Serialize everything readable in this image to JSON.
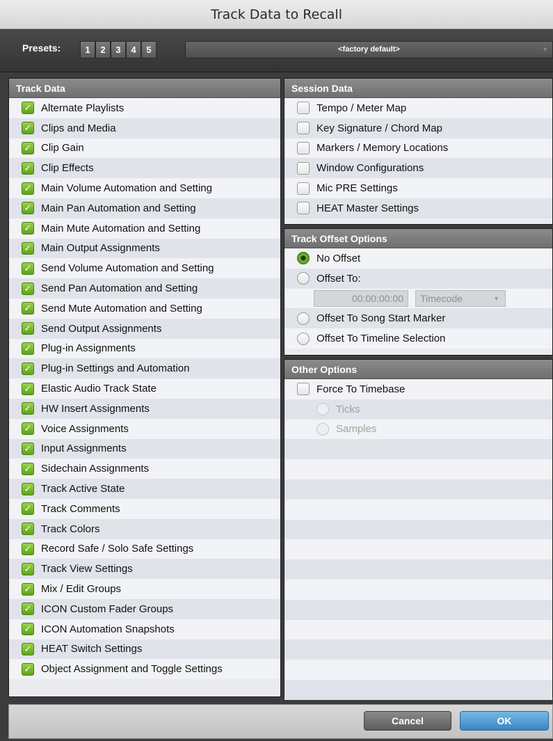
{
  "window": {
    "title": "Track Data to Recall"
  },
  "presets": {
    "label": "Presets:",
    "buttons": [
      "1",
      "2",
      "3",
      "4",
      "5"
    ],
    "selected": "<factory default>"
  },
  "track_data": {
    "header": "Track Data",
    "items": [
      {
        "label": "Alternate Playlists",
        "checked": true
      },
      {
        "label": "Clips and Media",
        "checked": true
      },
      {
        "label": "Clip Gain",
        "checked": true
      },
      {
        "label": "Clip Effects",
        "checked": true
      },
      {
        "label": "Main Volume Automation and Setting",
        "checked": true
      },
      {
        "label": "Main Pan Automation and Setting",
        "checked": true
      },
      {
        "label": "Main Mute Automation and Setting",
        "checked": true
      },
      {
        "label": "Main Output Assignments",
        "checked": true
      },
      {
        "label": "Send Volume Automation and Setting",
        "checked": true
      },
      {
        "label": "Send Pan Automation and Setting",
        "checked": true
      },
      {
        "label": "Send Mute Automation and Setting",
        "checked": true
      },
      {
        "label": "Send Output Assignments",
        "checked": true
      },
      {
        "label": "Plug-in Assignments",
        "checked": true
      },
      {
        "label": "Plug-in Settings and Automation",
        "checked": true
      },
      {
        "label": "Elastic Audio Track State",
        "checked": true
      },
      {
        "label": "HW Insert Assignments",
        "checked": true
      },
      {
        "label": "Voice Assignments",
        "checked": true
      },
      {
        "label": "Input Assignments",
        "checked": true
      },
      {
        "label": "Sidechain Assignments",
        "checked": true
      },
      {
        "label": "Track Active State",
        "checked": true
      },
      {
        "label": "Track Comments",
        "checked": true
      },
      {
        "label": "Track Colors",
        "checked": true
      },
      {
        "label": "Record Safe / Solo Safe Settings",
        "checked": true
      },
      {
        "label": "Track View Settings",
        "checked": true
      },
      {
        "label": "Mix / Edit Groups",
        "checked": true
      },
      {
        "label": "ICON Custom Fader Groups",
        "checked": true
      },
      {
        "label": "ICON Automation Snapshots",
        "checked": true
      },
      {
        "label": "HEAT Switch Settings",
        "checked": true
      },
      {
        "label": "Object Assignment and Toggle Settings",
        "checked": true
      }
    ]
  },
  "session_data": {
    "header": "Session Data",
    "items": [
      {
        "label": "Tempo / Meter Map",
        "checked": false
      },
      {
        "label": "Key Signature / Chord Map",
        "checked": false
      },
      {
        "label": "Markers / Memory Locations",
        "checked": false
      },
      {
        "label": "Window Configurations",
        "checked": false
      },
      {
        "label": "Mic PRE Settings",
        "checked": false
      },
      {
        "label": "HEAT Master Settings",
        "checked": false
      }
    ]
  },
  "offset_options": {
    "header": "Track Offset Options",
    "no_offset": "No Offset",
    "offset_to": "Offset To:",
    "timecode_value": "00:00:00:00",
    "timecode_format": "Timecode",
    "song_start": "Offset To Song Start Marker",
    "timeline_selection": "Offset To Timeline Selection",
    "selected": "No Offset"
  },
  "other_options": {
    "header": "Other Options",
    "force_timebase": "Force To Timebase",
    "force_timebase_checked": false,
    "ticks": "Ticks",
    "samples": "Samples"
  },
  "footer": {
    "cancel": "Cancel",
    "ok": "OK"
  },
  "colors": {
    "accent_green": "#6bb42a",
    "ok_blue": "#3b86c2"
  }
}
